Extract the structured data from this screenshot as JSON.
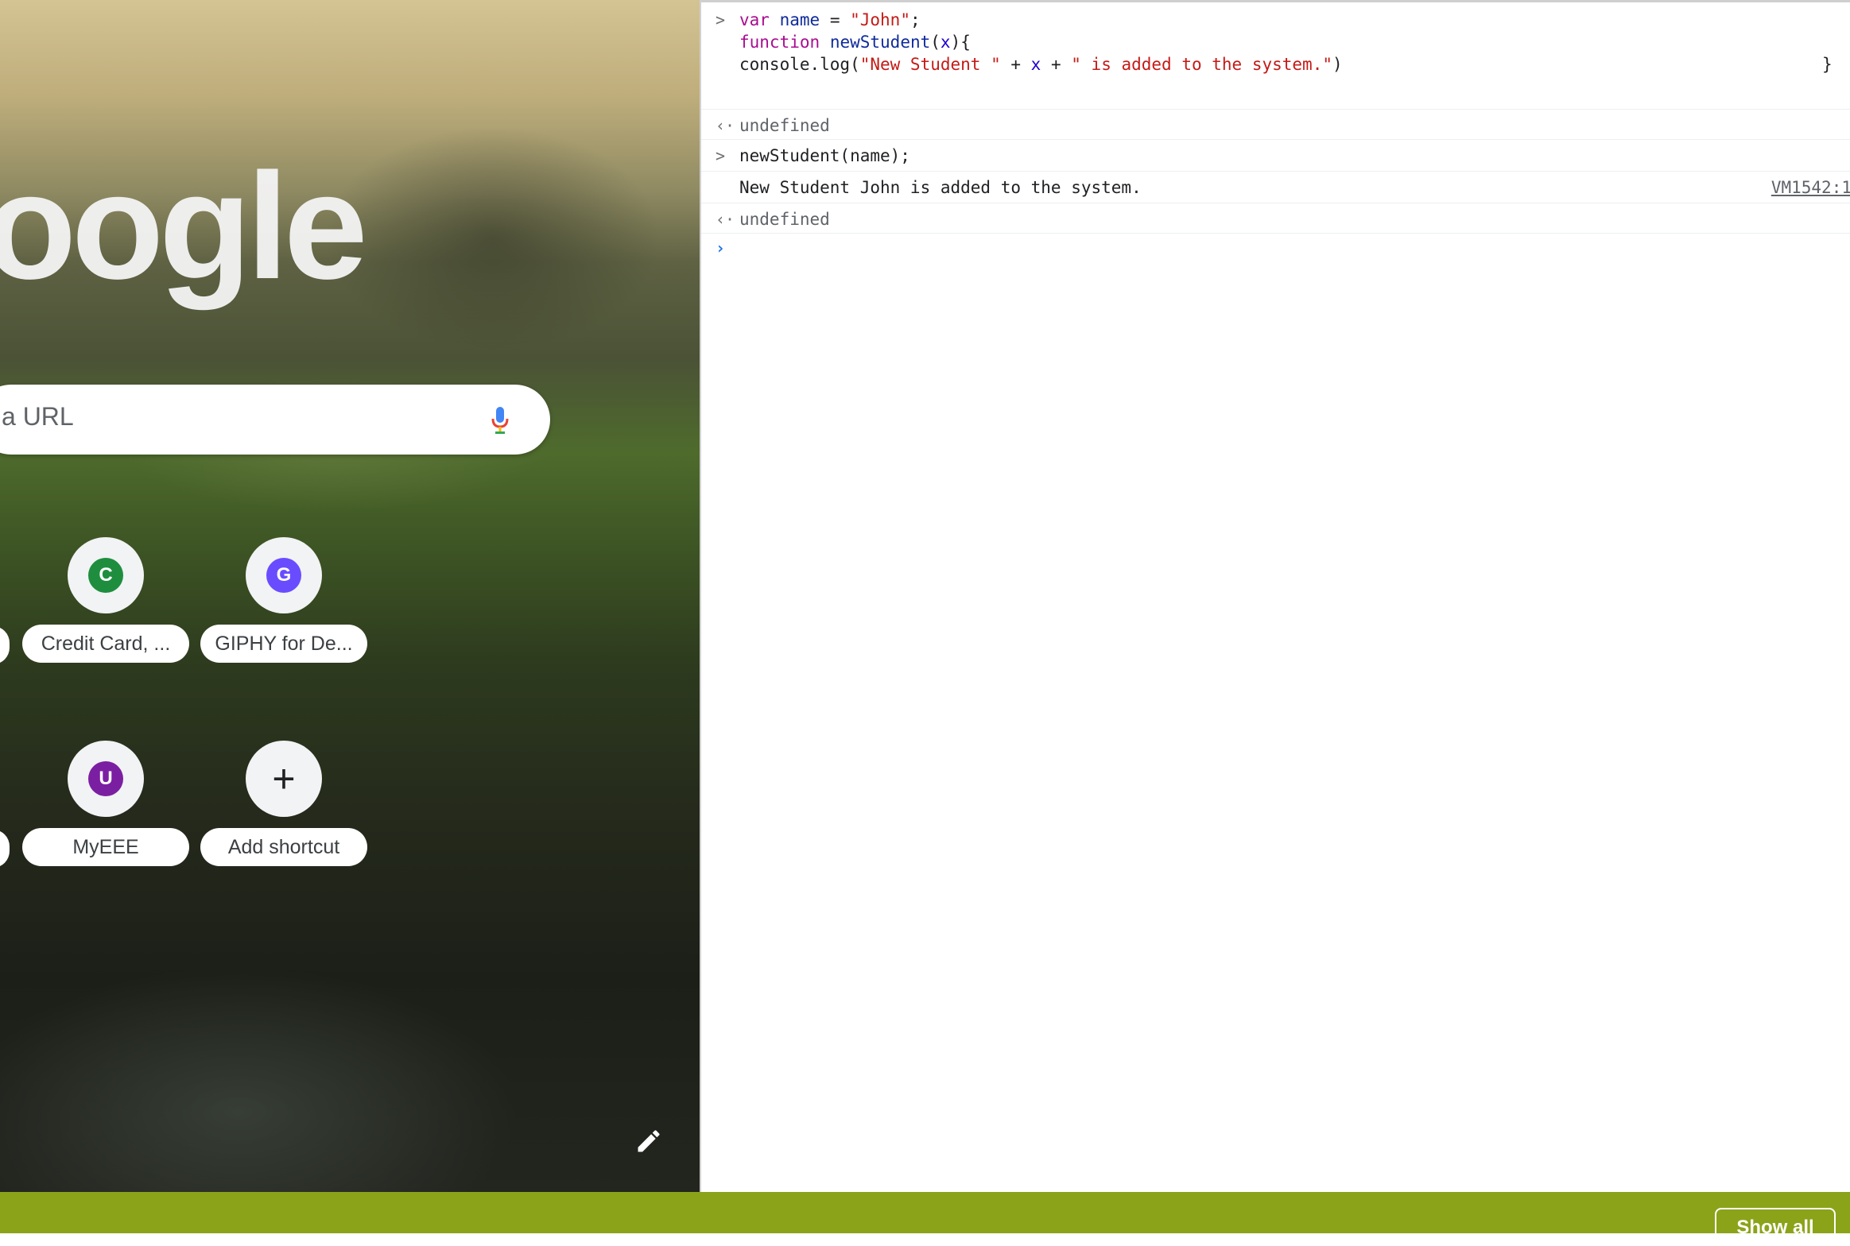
{
  "ntp": {
    "logo_text": "oogle",
    "search_placeholder": "a URL",
    "shortcuts": [
      {
        "label": "Credit Card, ...",
        "letter": "C",
        "color": "#1e8e3e"
      },
      {
        "label": "GIPHY for De...",
        "letter": "G",
        "color": "#6a4cff"
      },
      {
        "label": "MyEEE",
        "letter": "U",
        "color": "#7b1fa2"
      },
      {
        "label": "Add shortcut",
        "letter": "+"
      }
    ]
  },
  "console": {
    "entries": [
      {
        "type": "input",
        "lines": [
          "var name = \"John\";",
          "function newStudent(x){",
          "console.log(\"New Student \" + x + \" is added to the system.\")"
        ],
        "trailing": "}"
      },
      {
        "type": "result",
        "text": "undefined"
      },
      {
        "type": "input",
        "text": "newStudent(name);"
      },
      {
        "type": "log",
        "text": "New Student John is added to the system.",
        "source": "VM1542:1"
      },
      {
        "type": "result",
        "text": "undefined"
      }
    ],
    "prompt_symbol": "›"
  },
  "download_bar": {
    "show_all_label": "Show all"
  }
}
